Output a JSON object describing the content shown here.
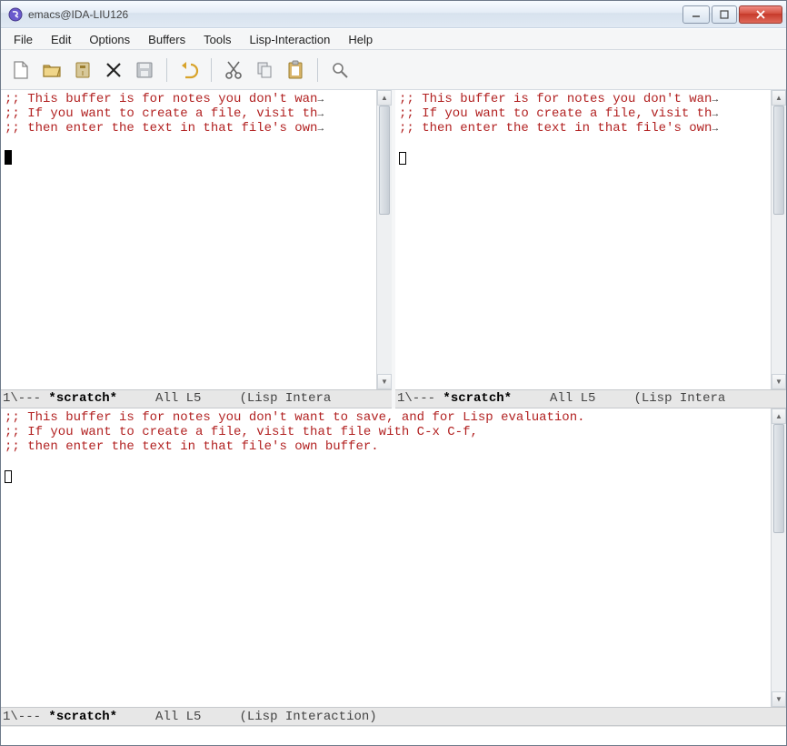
{
  "window": {
    "title": "emacs@IDA-LIU126"
  },
  "menu": {
    "items": [
      "File",
      "Edit",
      "Options",
      "Buffers",
      "Tools",
      "Lisp-Interaction",
      "Help"
    ]
  },
  "toolbar": {
    "icons": [
      "new-file",
      "open-folder",
      "directory",
      "close",
      "save",
      "undo",
      "cut",
      "copy",
      "paste",
      "search"
    ]
  },
  "buffer_text": {
    "line1": ";; This buffer is for notes you don't want to save, and for Lisp evaluation.",
    "line2": ";; If you want to create a file, visit that file with C-x C-f,",
    "line3": ";; then enter the text in that file's own buffer.",
    "line1_trunc": ";; This buffer is for notes you don't wan",
    "line2_trunc": ";; If you want to create a file, visit th",
    "line3_trunc": ";; then enter the text in that file's own"
  },
  "modeline": {
    "prefix": "1\\--- ",
    "bufname": "*scratch*",
    "pos": "     All L5     ",
    "mode_trunc": "(Lisp Intera",
    "mode_full": "(Lisp Interaction)"
  }
}
